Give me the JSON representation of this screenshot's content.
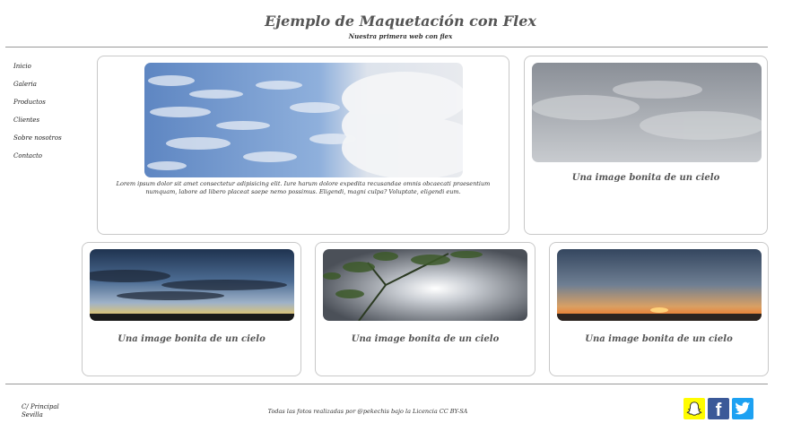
{
  "header": {
    "title": "Ejemplo de Maquetación con Flex",
    "subtitle": "Nuestra primera web con flex"
  },
  "nav": {
    "items": [
      {
        "label": "Inicio"
      },
      {
        "label": "Galeria"
      },
      {
        "label": "Productos"
      },
      {
        "label": "Clientes"
      },
      {
        "label": "Sobre nosotros"
      },
      {
        "label": "Contacto"
      }
    ]
  },
  "gallery": {
    "featured": {
      "text": "Lorem ipsum dolor sit amet consectetur adipisicing elit. Iure harum dolore expedita recusandae omnis obcaecati praesentium numquam, labore ad libero placeat saepe nemo possimus. Eligendi, magni culpa? Voluptate, eligendi eum."
    },
    "cards": [
      {
        "caption": "Una image bonita de un cielo"
      },
      {
        "caption": "Una image bonita de un cielo"
      },
      {
        "caption": "Una image bonita de un cielo"
      },
      {
        "caption": "Una image bonita de un cielo"
      }
    ]
  },
  "footer": {
    "address_line1": "C/ Principal",
    "address_line2": "Sevilla",
    "credit": "Todas las fotos realizadas por @pekechis bajo la Licencia CC BY-SA",
    "social": [
      {
        "icon": "snapchat-icon",
        "color": "#FFFC00"
      },
      {
        "icon": "facebook-icon",
        "color": "#3b5998"
      },
      {
        "icon": "twitter-icon",
        "color": "#1da1f2"
      }
    ]
  }
}
